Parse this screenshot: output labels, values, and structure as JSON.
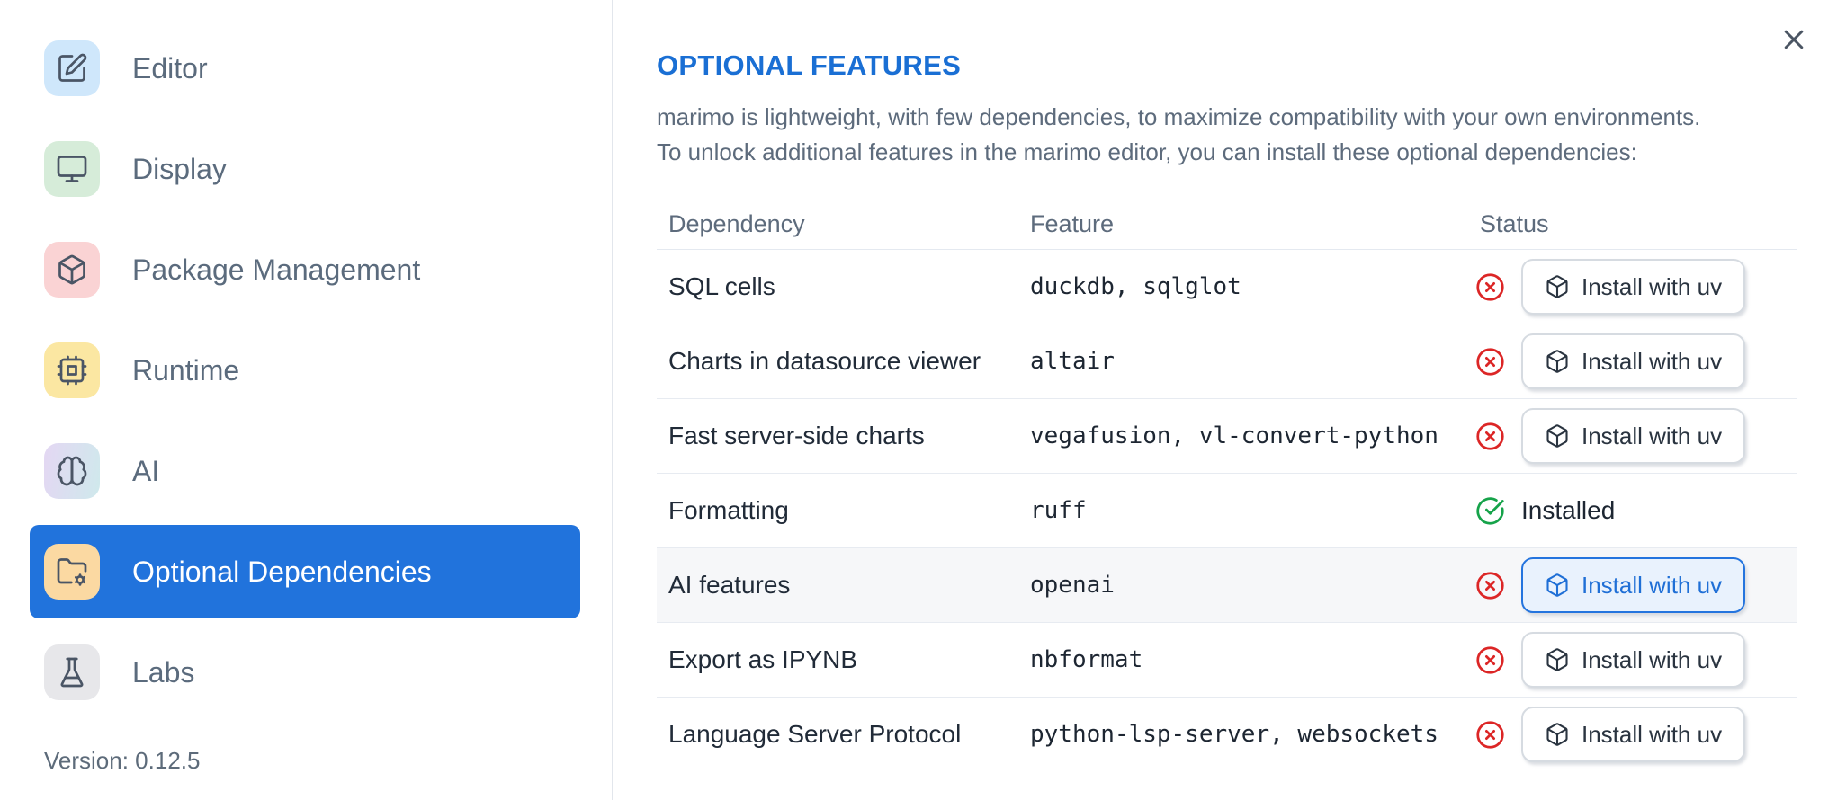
{
  "sidebar": {
    "items": [
      {
        "label": "Editor",
        "icon": "square-pen-icon",
        "icon_bg": "#cfe7fb",
        "selected": false
      },
      {
        "label": "Display",
        "icon": "monitor-icon",
        "icon_bg": "#d6ecd9",
        "selected": false
      },
      {
        "label": "Package Management",
        "icon": "package-icon",
        "icon_bg": "#fad3d4",
        "selected": false
      },
      {
        "label": "Runtime",
        "icon": "cpu-icon",
        "icon_bg": "#fbe7a2",
        "selected": false
      },
      {
        "label": "AI",
        "icon": "brain-icon",
        "icon_bg": "linear-gradient(100deg,#e4d7f3 0%,#cfe9ec 100%)",
        "selected": false
      },
      {
        "label": "Optional Dependencies",
        "icon": "folder-cog-icon",
        "icon_bg": "#fbd9a2",
        "selected": true
      },
      {
        "label": "Labs",
        "icon": "flask-icon",
        "icon_bg": "#e7e7ea",
        "selected": false
      }
    ],
    "version": "Version: 0.12.5"
  },
  "dialog": {
    "title": "OPTIONAL FEATURES",
    "description": [
      "marimo is lightweight, with few dependencies, to maximize compatibility with your own environments.",
      "To unlock additional features in the marimo editor, you can install these optional dependencies:"
    ],
    "table": {
      "headers": [
        "Dependency",
        "Feature",
        "Status"
      ],
      "install_button_label": "Install with uv",
      "installed_label": "Installed",
      "rows": [
        {
          "dependency": "SQL cells",
          "feature": "duckdb, sqlglot",
          "installed": false,
          "highlighted": false,
          "button_focused": false
        },
        {
          "dependency": "Charts in datasource viewer",
          "feature": "altair",
          "installed": false,
          "highlighted": false,
          "button_focused": false
        },
        {
          "dependency": "Fast server-side charts",
          "feature": "vegafusion, vl-convert-python",
          "installed": false,
          "highlighted": false,
          "button_focused": false
        },
        {
          "dependency": "Formatting",
          "feature": "ruff",
          "installed": true,
          "highlighted": false,
          "button_focused": false
        },
        {
          "dependency": "AI features",
          "feature": "openai",
          "installed": false,
          "highlighted": true,
          "button_focused": true
        },
        {
          "dependency": "Export as IPYNB",
          "feature": "nbformat",
          "installed": false,
          "highlighted": false,
          "button_focused": false
        },
        {
          "dependency": "Language Server Protocol",
          "feature": "python-lsp-server, websockets",
          "installed": false,
          "highlighted": false,
          "button_focused": false
        }
      ]
    }
  },
  "colors": {
    "accent_blue": "#1f6fd6",
    "title_blue": "#1a6fd4",
    "selected_item_bg": "#2173dc",
    "error_red": "#dc2626",
    "success_green": "#16a34a",
    "row_highlight": "#f6f7f9"
  }
}
